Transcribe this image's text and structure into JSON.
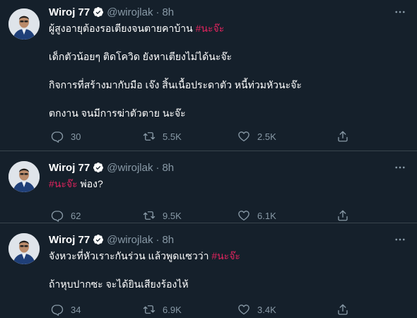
{
  "tweets": [
    {
      "name": "Wiroj 77",
      "handle": "@wirojlak",
      "dot": "·",
      "time": "8h",
      "text": {
        "l1_a": "ผู้สูงอายุต้องรอเตียงจนตายคาบ้าน ",
        "l1_tag": "#นะจ๊ะ",
        "l2": "เด็กตัวน้อยๆ ติดโควิด ยังหาเตียงไม่ได้นะจ๊ะ",
        "l3": "กิจการที่สร้างมากับมือ เจ๊ง สิ้นเนื้อประดาตัว หนี้ท่วมหัวนะจ๊ะ",
        "l4": "ตกงาน จนมีการฆ่าตัวตาย นะจ๊ะ"
      },
      "replies": "30",
      "retweets": "5.5K",
      "likes": "2.5K"
    },
    {
      "name": "Wiroj 77",
      "handle": "@wirojlak",
      "dot": "·",
      "time": "8h",
      "text": {
        "l1_tag": "#นะจ๊ะ",
        "l1_b": " พ่อง?"
      },
      "replies": "62",
      "retweets": "9.5K",
      "likes": "6.1K"
    },
    {
      "name": "Wiroj 77",
      "handle": "@wirojlak",
      "dot": "·",
      "time": "8h",
      "text": {
        "l1_a": "จังหวะที่หัวเราะกันร่วน แล้วพูดแซวว่า ",
        "l1_tag": "#นะจ๊ะ",
        "l2": "ถ้าหุบปากซะ จะได้ยินเสียงร้องไห้"
      },
      "replies": "34",
      "retweets": "6.9K",
      "likes": "3.4K"
    }
  ],
  "icons": {
    "verified": "verified-badge-icon",
    "more": "more-dots-icon",
    "reply": "reply-icon",
    "retweet": "retweet-icon",
    "like": "heart-icon",
    "share": "share-icon"
  },
  "colors": {
    "background": "#15202b",
    "divider": "#38444d",
    "muted": "#8899a6",
    "hashtag": "#e0245e",
    "verified": "#ffffff"
  }
}
